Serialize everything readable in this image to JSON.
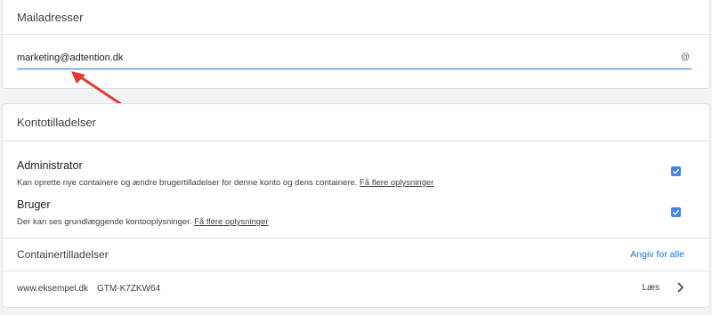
{
  "email_section": {
    "title": "Mailadresser",
    "email_value": "marketing@adtention.dk",
    "at_symbol": "@"
  },
  "account_permissions": {
    "title": "Kontotilladelser",
    "items": [
      {
        "title": "Administrator",
        "description": "Kan oprette nye containere og ændre brugertilladelser for denne konto og dens containere.",
        "link": "Få flere oplysninger",
        "checked": true
      },
      {
        "title": "Bruger",
        "description": "Der kan ses grundlæggende kontooplysninger.",
        "link": "Få flere oplysninger",
        "checked": true
      }
    ]
  },
  "container_permissions": {
    "title": "Containertilladelser",
    "set_all_label": "Angiv for alle",
    "rows": [
      {
        "name": "www.eksempel.dk",
        "id": "GTM-K7ZKW64",
        "permission": "Læs"
      }
    ]
  },
  "colors": {
    "accent": "#1a73e8",
    "checkbox": "#4285f4",
    "annotation_arrow": "#e53935"
  },
  "icons": [
    "at-icon",
    "check-icon",
    "chevron-right-icon",
    "annotation-arrow-icon"
  ]
}
